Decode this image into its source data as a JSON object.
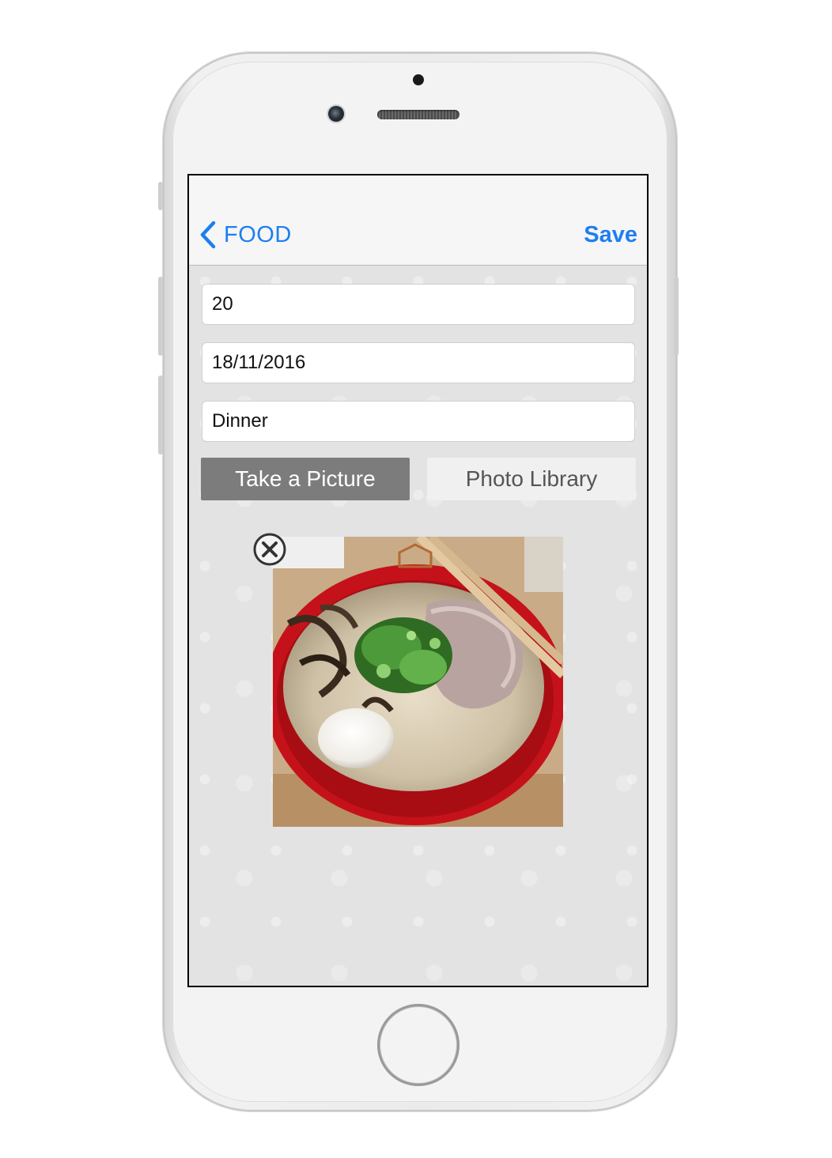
{
  "navbar": {
    "back_label": "FOOD",
    "save_label": "Save"
  },
  "form": {
    "amount_value": "20",
    "date_value": "18/11/2016",
    "category_value": "Dinner"
  },
  "buttons": {
    "take_picture_label": "Take a Picture",
    "photo_library_label": "Photo Library"
  },
  "photo": {
    "icon": "ramen-photo",
    "remove_icon": "close-circle-icon"
  },
  "colors": {
    "accent": "#1d7ef2",
    "take_button_bg": "#7c7c7c",
    "library_button_bg": "#f0f0f0",
    "screen_bg": "#e2e2e2"
  }
}
